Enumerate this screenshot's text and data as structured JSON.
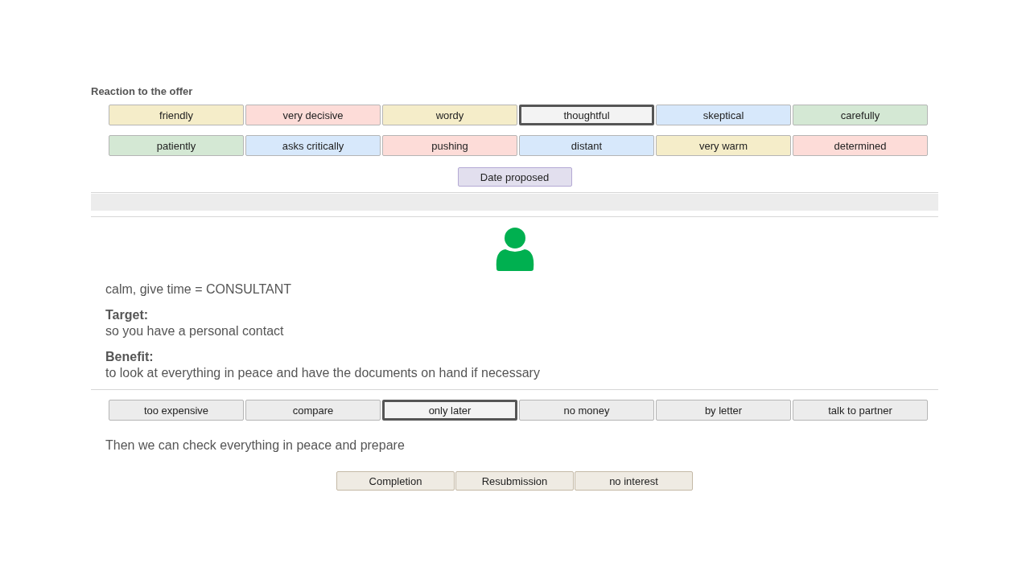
{
  "reaction": {
    "heading": "Reaction to the offer",
    "options": [
      {
        "label": "friendly",
        "color": "#f5edc9",
        "selected": false
      },
      {
        "label": "very decisive",
        "color": "#fddcd8",
        "selected": false
      },
      {
        "label": "wordy",
        "color": "#f5edc9",
        "selected": false
      },
      {
        "label": "thoughtful",
        "color": "#f3f3f3",
        "selected": true
      },
      {
        "label": "skeptical",
        "color": "#d7e8fb",
        "selected": false
      },
      {
        "label": "carefully",
        "color": "#d4e8d4",
        "selected": false
      },
      {
        "label": "patiently",
        "color": "#d4e8d4",
        "selected": false
      },
      {
        "label": "asks critically",
        "color": "#d7e8fb",
        "selected": false
      },
      {
        "label": "pushing",
        "color": "#fddcd8",
        "selected": false
      },
      {
        "label": "distant",
        "color": "#d7e8fb",
        "selected": false
      },
      {
        "label": "very warm",
        "color": "#f5edc9",
        "selected": false
      },
      {
        "label": "determined",
        "color": "#fddcd8",
        "selected": false
      }
    ],
    "date_button": "Date proposed"
  },
  "profile": {
    "type_line": "calm, give time = CONSULTANT",
    "target": {
      "label": "Target:",
      "text": "so you have a personal contact"
    },
    "benefit": {
      "label": "Benefit:",
      "text": "to look at everything in peace and have the documents on hand if necessary"
    }
  },
  "objections": [
    {
      "label": "too expensive",
      "selected": false
    },
    {
      "label": "compare",
      "selected": false
    },
    {
      "label": "only later",
      "selected": true
    },
    {
      "label": "no money",
      "selected": false
    },
    {
      "label": "by letter",
      "selected": false
    },
    {
      "label": "talk to partner",
      "selected": false
    }
  ],
  "response": "Then we can check everything in peace and prepare",
  "actions": [
    "Completion",
    "Resubmission",
    "no interest"
  ]
}
